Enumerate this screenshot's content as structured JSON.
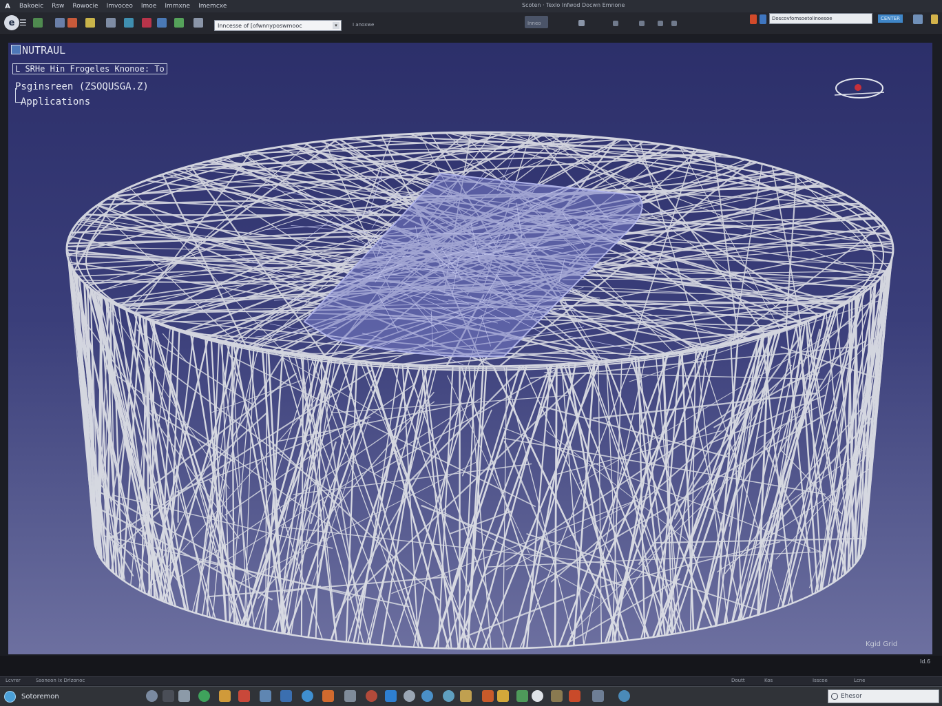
{
  "menubar": {
    "logo": "A",
    "items": [
      "Bakoeic",
      "Rsw",
      "Rowocie",
      "Imvoceo",
      "Imoe",
      "Immxne",
      "Imemcxe"
    ],
    "window_title": "Scoten · Texlo Infwod Docwn Emnone"
  },
  "toolbar": {
    "app_logo": "e",
    "app_menu_glyph": "☰",
    "address_value": "Inncesse of [ofwnnyposwmooc",
    "extra_label": "I anoxwe",
    "view_label": "Inneo",
    "right_field_value": "Doscovfomsoetolinoesoe",
    "right_button_label": "CENTER",
    "colors": {
      "accent": "#3f86c8",
      "toolbar_bg": "#25272e"
    }
  },
  "tree": {
    "root_label": "NUTRAUL",
    "node1_label": "L SRHe Hin Frogeles",
    "node1_suffix": "Knonoe: To",
    "node2_label": "Psginsreen  (ZSOQUSGA.Z)",
    "node3_label": "Applications"
  },
  "viewport": {
    "compass_icon": "eye-compass-icon",
    "scale_label": "Kgid Grid",
    "coord_label": "Id.6"
  },
  "statusbar": {
    "items": [
      "Lcvrer",
      "Ssoneon Ix Drlzonoc"
    ],
    "right_items": [
      "Doutt",
      "Kos",
      "Isscoe",
      "Lcne"
    ]
  },
  "taskbar": {
    "start_label": "Sotoremon",
    "search_placeholder": "Ehesor",
    "search_icon": "search-icon"
  }
}
